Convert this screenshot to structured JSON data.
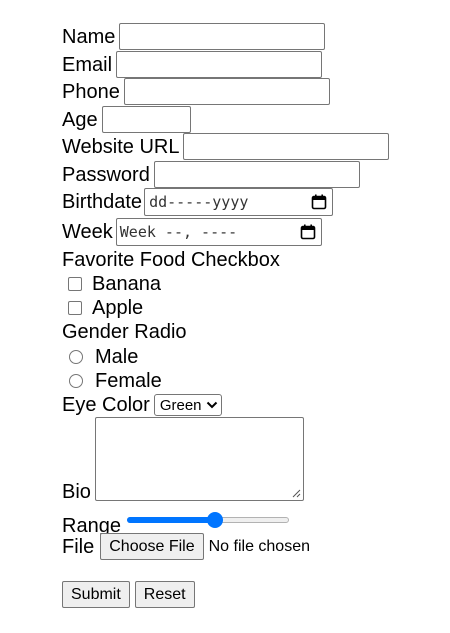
{
  "form": {
    "name_label": "Name",
    "email_label": "Email",
    "phone_label": "Phone",
    "age_label": "Age",
    "website_label": "Website URL",
    "password_label": "Password",
    "birthdate_label": "Birthdate",
    "birthdate_placeholder": "dd-----yyyy",
    "week_label": "Week",
    "week_placeholder": "Week --, ----",
    "food_label": "Favorite Food Checkbox",
    "food_options": [
      "Banana",
      "Apple"
    ],
    "gender_label": "Gender Radio",
    "gender_options": [
      "Male",
      "Female"
    ],
    "eye_color_label": "Eye Color",
    "eye_color_selected": "Green",
    "bio_label": "Bio",
    "range_label": "Range",
    "range_value": 0.55,
    "file_label": "File",
    "file_button": "Choose File",
    "file_status": "No file chosen",
    "submit_label": "Submit",
    "reset_label": "Reset"
  },
  "colors": {
    "accent": "#0075ff",
    "border": "#767676",
    "button_bg": "#efefef"
  },
  "icons": {
    "calendar": "calendar-icon",
    "select_arrow": "chevron-down-icon",
    "resize": "resize-grip-icon"
  }
}
